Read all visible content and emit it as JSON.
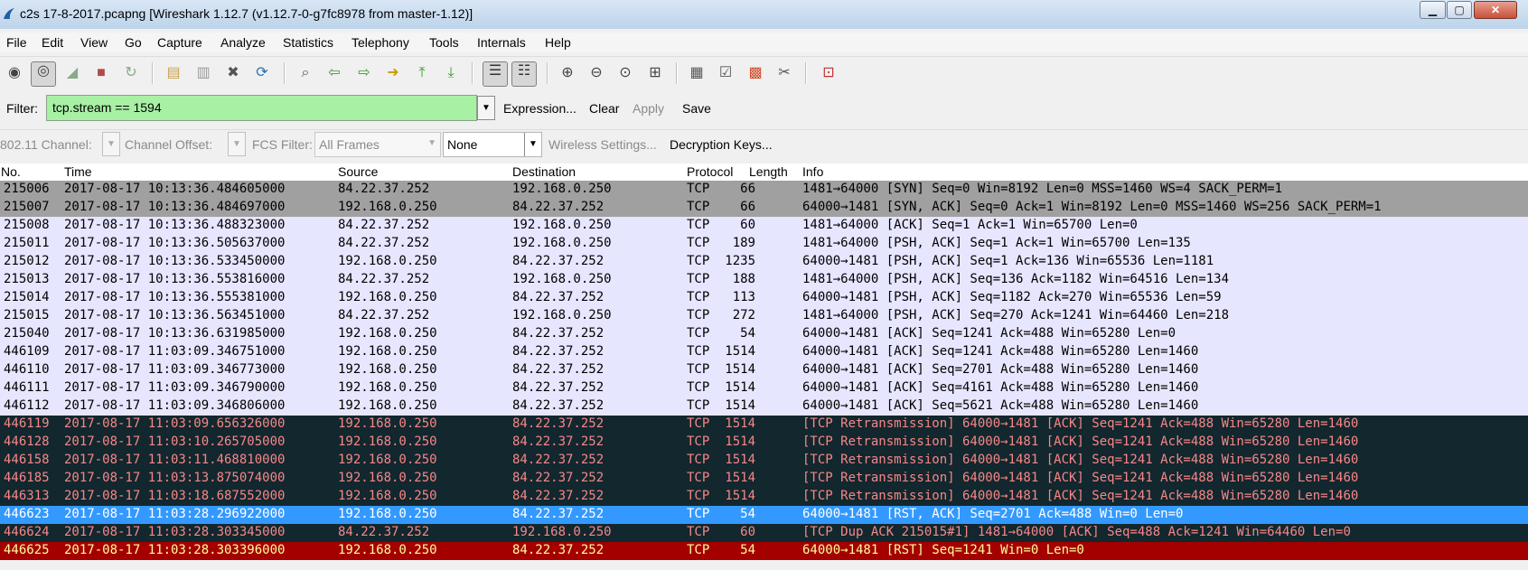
{
  "window": {
    "title": "c2s 17-8-2017.pcapng   [Wireshark 1.12.7  (v1.12.7-0-g7fc8978 from master-1.12)]",
    "minimize_glyph": "▁",
    "maximize_glyph": "▢",
    "close_glyph": "✕"
  },
  "menubar": [
    {
      "label": "File"
    },
    {
      "label": "Edit"
    },
    {
      "label": "View"
    },
    {
      "label": "Go"
    },
    {
      "label": "Capture"
    },
    {
      "label": "Analyze"
    },
    {
      "label": "Statistics"
    },
    {
      "label": "Telephony"
    },
    {
      "label": "Tools"
    },
    {
      "label": "Internals"
    },
    {
      "label": "Help"
    }
  ],
  "toolbar": {
    "icons": [
      {
        "name": "interfaces-icon",
        "glyph": "◉",
        "color": "#444444"
      },
      {
        "name": "capture-options-icon",
        "glyph": "◎",
        "color": "#444444"
      },
      {
        "name": "start-capture-icon",
        "glyph": "◢",
        "color": "#8aa88a"
      },
      {
        "name": "stop-capture-icon",
        "glyph": "■",
        "color": "#b04a4a"
      },
      {
        "name": "restart-capture-icon",
        "glyph": "↻",
        "color": "#8aa88a"
      },
      {
        "name": "open-file-icon",
        "glyph": "▤",
        "color": "#c9a34a"
      },
      {
        "name": "save-file-icon",
        "glyph": "▥",
        "color": "#9a9a9a"
      },
      {
        "name": "close-file-icon",
        "glyph": "✖",
        "color": "#555555"
      },
      {
        "name": "reload-icon",
        "glyph": "⟳",
        "color": "#2f6fb5"
      },
      {
        "name": "find-packet-icon",
        "glyph": "⌕",
        "color": "#555555"
      },
      {
        "name": "go-back-icon",
        "glyph": "⇦",
        "color": "#3a9a2a"
      },
      {
        "name": "go-forward-icon",
        "glyph": "⇨",
        "color": "#3a9a2a"
      },
      {
        "name": "go-to-packet-icon",
        "glyph": "➜",
        "color": "#c8a000"
      },
      {
        "name": "first-packet-icon",
        "glyph": "⤒",
        "color": "#3a9a2a"
      },
      {
        "name": "last-packet-icon",
        "glyph": "⤓",
        "color": "#3a9a2a"
      },
      {
        "name": "colorize-icon",
        "glyph": "☰",
        "color": "#333333"
      },
      {
        "name": "auto-scroll-icon",
        "glyph": "☷",
        "color": "#333333"
      },
      {
        "name": "zoom-in-icon",
        "glyph": "⊕",
        "color": "#444444"
      },
      {
        "name": "zoom-out-icon",
        "glyph": "⊖",
        "color": "#444444"
      },
      {
        "name": "normal-size-icon",
        "glyph": "⊙",
        "color": "#444444"
      },
      {
        "name": "resize-columns-icon",
        "glyph": "⊞",
        "color": "#444444"
      },
      {
        "name": "capture-filters-icon",
        "glyph": "▦",
        "color": "#555555"
      },
      {
        "name": "display-filters-icon",
        "glyph": "☑",
        "color": "#555555"
      },
      {
        "name": "coloring-rules-icon",
        "glyph": "▩",
        "color": "#d04a2a"
      },
      {
        "name": "preferences-icon",
        "glyph": "✂",
        "color": "#555555"
      },
      {
        "name": "help-icon",
        "glyph": "⊡",
        "color": "#c03030"
      }
    ]
  },
  "filter": {
    "label": "Filter:",
    "value": "tcp.stream == 1594",
    "dropdown_glyph": "▼",
    "expression_label": "Expression...",
    "clear_label": "Clear",
    "apply_label": "Apply",
    "save_label": "Save",
    "input_color": "#a8f0a4"
  },
  "wireless": {
    "channel_label": "802.11 Channel:",
    "channel_offset_label": "Channel Offset:",
    "fcs_filter_label": "FCS Filter:",
    "fcs_filter_value": "All Frames",
    "decryption_mode_value": "None",
    "wireless_settings_label": "Wireless Settings...",
    "decryption_keys_label": "Decryption Keys...",
    "dropdown_glyph": "▼"
  },
  "packet_list": {
    "columns": [
      "No.",
      "Time",
      "Source",
      "Destination",
      "Protocol",
      "Length",
      "Info"
    ],
    "rows": [
      {
        "no": "215006",
        "time": "2017-08-17 10:13:36.484605000",
        "source": "84.22.37.252",
        "destination": "192.168.0.250",
        "protocol": "TCP",
        "length": "66",
        "info": "1481→64000 [SYN] Seq=0 Win=8192 Len=0 MSS=1460 WS=4 SACK_PERM=1",
        "bg": "#a0a0a0",
        "fg": "#000000"
      },
      {
        "no": "215007",
        "time": "2017-08-17 10:13:36.484697000",
        "source": "192.168.0.250",
        "destination": "84.22.37.252",
        "protocol": "TCP",
        "length": "66",
        "info": "64000→1481 [SYN, ACK] Seq=0 Ack=1 Win=8192 Len=0 MSS=1460 WS=256 SACK_PERM=1",
        "bg": "#a0a0a0",
        "fg": "#000000"
      },
      {
        "no": "215008",
        "time": "2017-08-17 10:13:36.488323000",
        "source": "84.22.37.252",
        "destination": "192.168.0.250",
        "protocol": "TCP",
        "length": "60",
        "info": "1481→64000 [ACK] Seq=1 Ack=1 Win=65700 Len=0",
        "bg": "#e7e6ff",
        "fg": "#000000"
      },
      {
        "no": "215011",
        "time": "2017-08-17 10:13:36.505637000",
        "source": "84.22.37.252",
        "destination": "192.168.0.250",
        "protocol": "TCP",
        "length": "189",
        "info": "1481→64000 [PSH, ACK] Seq=1 Ack=1 Win=65700 Len=135",
        "bg": "#e7e6ff",
        "fg": "#000000"
      },
      {
        "no": "215012",
        "time": "2017-08-17 10:13:36.533450000",
        "source": "192.168.0.250",
        "destination": "84.22.37.252",
        "protocol": "TCP",
        "length": "1235",
        "info": "64000→1481 [PSH, ACK] Seq=1 Ack=136 Win=65536 Len=1181",
        "bg": "#e7e6ff",
        "fg": "#000000"
      },
      {
        "no": "215013",
        "time": "2017-08-17 10:13:36.553816000",
        "source": "84.22.37.252",
        "destination": "192.168.0.250",
        "protocol": "TCP",
        "length": "188",
        "info": "1481→64000 [PSH, ACK] Seq=136 Ack=1182 Win=64516 Len=134",
        "bg": "#e7e6ff",
        "fg": "#000000"
      },
      {
        "no": "215014",
        "time": "2017-08-17 10:13:36.555381000",
        "source": "192.168.0.250",
        "destination": "84.22.37.252",
        "protocol": "TCP",
        "length": "113",
        "info": "64000→1481 [PSH, ACK] Seq=1182 Ack=270 Win=65536 Len=59",
        "bg": "#e7e6ff",
        "fg": "#000000"
      },
      {
        "no": "215015",
        "time": "2017-08-17 10:13:36.563451000",
        "source": "84.22.37.252",
        "destination": "192.168.0.250",
        "protocol": "TCP",
        "length": "272",
        "info": "1481→64000 [PSH, ACK] Seq=270 Ack=1241 Win=64460 Len=218",
        "bg": "#e7e6ff",
        "fg": "#000000"
      },
      {
        "no": "215040",
        "time": "2017-08-17 10:13:36.631985000",
        "source": "192.168.0.250",
        "destination": "84.22.37.252",
        "protocol": "TCP",
        "length": "54",
        "info": "64000→1481 [ACK] Seq=1241 Ack=488 Win=65280 Len=0",
        "bg": "#e7e6ff",
        "fg": "#000000"
      },
      {
        "no": "446109",
        "time": "2017-08-17 11:03:09.346751000",
        "source": "192.168.0.250",
        "destination": "84.22.37.252",
        "protocol": "TCP",
        "length": "1514",
        "info": "64000→1481 [ACK] Seq=1241 Ack=488 Win=65280 Len=1460",
        "bg": "#e7e6ff",
        "fg": "#000000"
      },
      {
        "no": "446110",
        "time": "2017-08-17 11:03:09.346773000",
        "source": "192.168.0.250",
        "destination": "84.22.37.252",
        "protocol": "TCP",
        "length": "1514",
        "info": "64000→1481 [ACK] Seq=2701 Ack=488 Win=65280 Len=1460",
        "bg": "#e7e6ff",
        "fg": "#000000"
      },
      {
        "no": "446111",
        "time": "2017-08-17 11:03:09.346790000",
        "source": "192.168.0.250",
        "destination": "84.22.37.252",
        "protocol": "TCP",
        "length": "1514",
        "info": "64000→1481 [ACK] Seq=4161 Ack=488 Win=65280 Len=1460",
        "bg": "#e7e6ff",
        "fg": "#000000"
      },
      {
        "no": "446112",
        "time": "2017-08-17 11:03:09.346806000",
        "source": "192.168.0.250",
        "destination": "84.22.37.252",
        "protocol": "TCP",
        "length": "1514",
        "info": "64000→1481 [ACK] Seq=5621 Ack=488 Win=65280 Len=1460",
        "bg": "#e7e6ff",
        "fg": "#000000"
      },
      {
        "no": "446119",
        "time": "2017-08-17 11:03:09.656326000",
        "source": "192.168.0.250",
        "destination": "84.22.37.252",
        "protocol": "TCP",
        "length": "1514",
        "info": "[TCP Retransmission] 64000→1481 [ACK] Seq=1241 Ack=488 Win=65280 Len=1460",
        "bg": "#12272e",
        "fg": "#f78787"
      },
      {
        "no": "446128",
        "time": "2017-08-17 11:03:10.265705000",
        "source": "192.168.0.250",
        "destination": "84.22.37.252",
        "protocol": "TCP",
        "length": "1514",
        "info": "[TCP Retransmission] 64000→1481 [ACK] Seq=1241 Ack=488 Win=65280 Len=1460",
        "bg": "#12272e",
        "fg": "#f78787"
      },
      {
        "no": "446158",
        "time": "2017-08-17 11:03:11.468810000",
        "source": "192.168.0.250",
        "destination": "84.22.37.252",
        "protocol": "TCP",
        "length": "1514",
        "info": "[TCP Retransmission] 64000→1481 [ACK] Seq=1241 Ack=488 Win=65280 Len=1460",
        "bg": "#12272e",
        "fg": "#f78787"
      },
      {
        "no": "446185",
        "time": "2017-08-17 11:03:13.875074000",
        "source": "192.168.0.250",
        "destination": "84.22.37.252",
        "protocol": "TCP",
        "length": "1514",
        "info": "[TCP Retransmission] 64000→1481 [ACK] Seq=1241 Ack=488 Win=65280 Len=1460",
        "bg": "#12272e",
        "fg": "#f78787"
      },
      {
        "no": "446313",
        "time": "2017-08-17 11:03:18.687552000",
        "source": "192.168.0.250",
        "destination": "84.22.37.252",
        "protocol": "TCP",
        "length": "1514",
        "info": "[TCP Retransmission] 64000→1481 [ACK] Seq=1241 Ack=488 Win=65280 Len=1460",
        "bg": "#12272e",
        "fg": "#f78787"
      },
      {
        "no": "446623",
        "time": "2017-08-17 11:03:28.296922000",
        "source": "192.168.0.250",
        "destination": "84.22.37.252",
        "protocol": "TCP",
        "length": "54",
        "info": "64000→1481 [RST, ACK] Seq=2701 Ack=488 Win=0 Len=0",
        "bg": "#3399ff",
        "fg": "#ffffff"
      },
      {
        "no": "446624",
        "time": "2017-08-17 11:03:28.303345000",
        "source": "84.22.37.252",
        "destination": "192.168.0.250",
        "protocol": "TCP",
        "length": "60",
        "info": "[TCP Dup ACK 215015#1] 1481→64000 [ACK] Seq=488 Ack=1241 Win=64460 Len=0",
        "bg": "#12272e",
        "fg": "#f78787"
      },
      {
        "no": "446625",
        "time": "2017-08-17 11:03:28.303396000",
        "source": "192.168.0.250",
        "destination": "84.22.37.252",
        "protocol": "TCP",
        "length": "54",
        "info": "64000→1481 [RST] Seq=1241 Win=0 Len=0",
        "bg": "#a40000",
        "fg": "#fffc9c"
      }
    ]
  }
}
